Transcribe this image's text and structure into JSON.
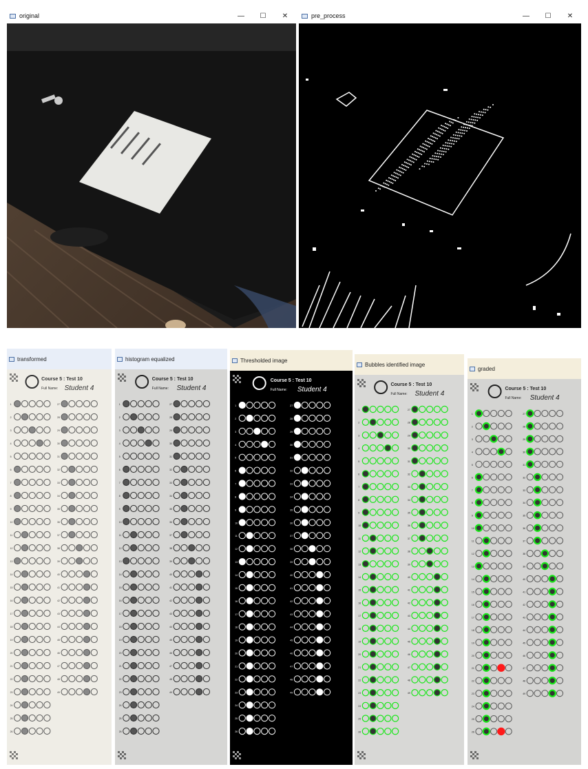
{
  "windows": {
    "original": {
      "title": "original"
    },
    "pre_process": {
      "title": "pre_process"
    },
    "transformed": {
      "title": "transformed"
    },
    "histogram": {
      "title": "histogram equalized"
    },
    "thresholded": {
      "title": "Thresholded image"
    },
    "bubbles": {
      "title": "Bubbles identified image"
    },
    "graded": {
      "title": "graded"
    }
  },
  "controls": {
    "minimize": "—",
    "maximize": "☐",
    "close": "✕"
  },
  "sheet": {
    "course": "Course 5 : Test 10",
    "name_label": "Full Name:",
    "student": "Student 4"
  },
  "colors": {
    "accent_green": "#19e619",
    "accent_red": "#ff1a1a"
  }
}
